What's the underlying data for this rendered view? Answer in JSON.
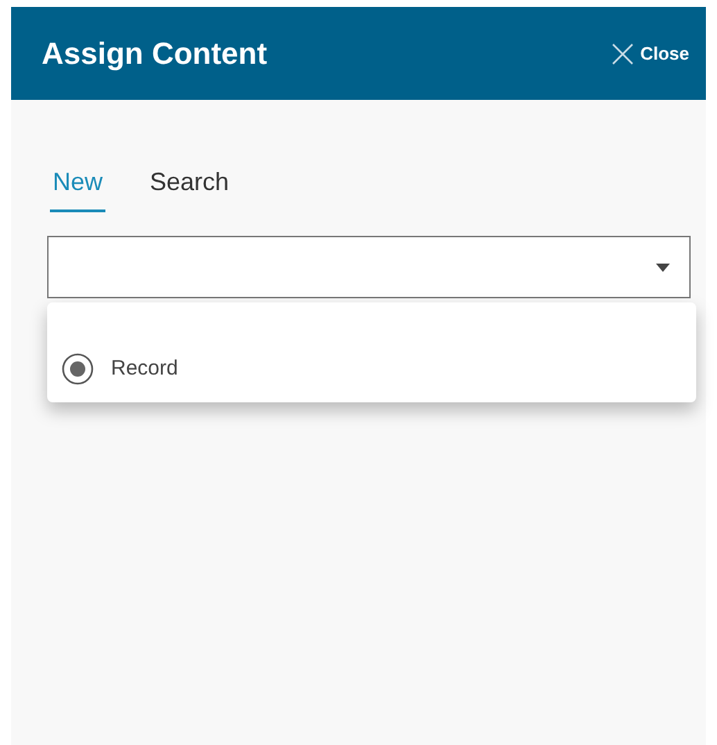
{
  "window": {
    "title": "Assign Content",
    "close_label": "Close"
  },
  "tabs": [
    {
      "label": "New",
      "selected": true
    },
    {
      "label": "Search",
      "selected": false
    }
  ],
  "dropdown": {
    "expanded": true,
    "options": [
      {
        "label": "Record",
        "selected": true
      }
    ]
  }
}
